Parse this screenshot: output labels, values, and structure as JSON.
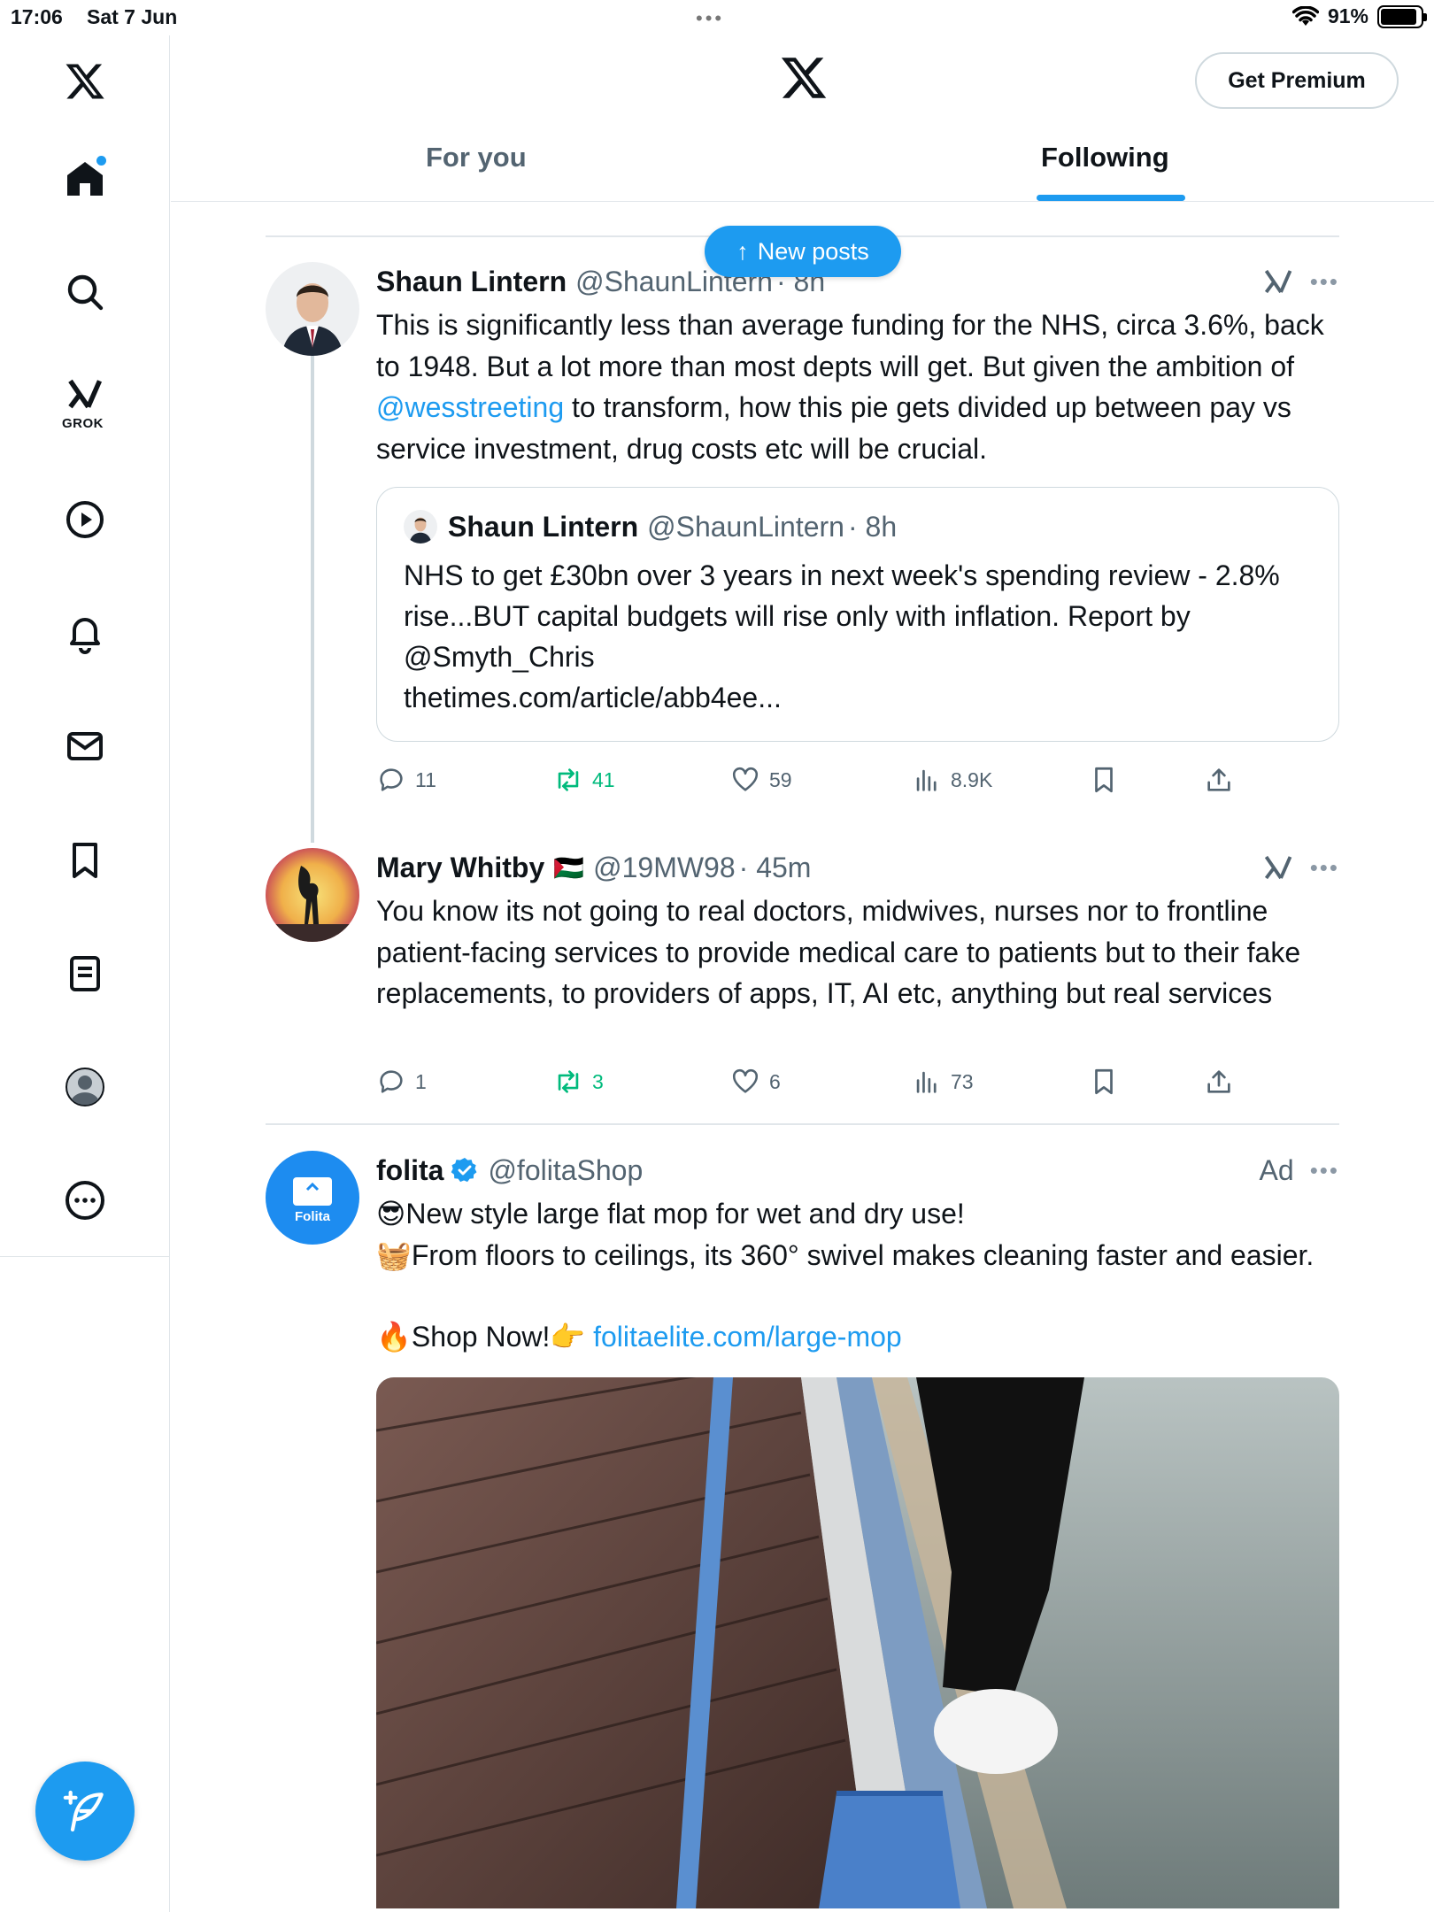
{
  "status_bar": {
    "time": "17:06",
    "date": "Sat 7 Jun",
    "battery": "91%"
  },
  "sidebar": {
    "grok_label": "GROK"
  },
  "header": {
    "premium_button": "Get Premium",
    "tabs": [
      "For you",
      "Following"
    ],
    "active_tab": "Following"
  },
  "new_posts_pill": "New posts",
  "posts": [
    {
      "author": "Shaun Lintern",
      "handle": "@ShaunLintern",
      "time": "· 8h",
      "text_before_mention": "This is significantly less than average funding for the NHS, circa 3.6%, back to 1948. But a lot more than most depts will get. But given the ambition of ",
      "mention": "@wesstreeting",
      "text_after_mention": " to transform, how this pie gets divided up between pay vs service investment, drug costs etc will be crucial.",
      "quote": {
        "author": "Shaun Lintern",
        "handle": "@ShaunLintern",
        "time": "· 8h",
        "text": "NHS to get £30bn over 3 years in next week's spending review - 2.8% rise...BUT capital budgets will rise only with inflation. Report by @Smyth_Chris",
        "link": "thetimes.com/article/abb4ee..."
      },
      "stats": {
        "replies": "11",
        "reposts": "41",
        "likes": "59",
        "views": "8.9K"
      }
    },
    {
      "author": "Mary Whitby",
      "flag": "🇵🇸",
      "handle": "@19MW98",
      "time": "· 45m",
      "text": "You know its not going to real doctors, midwives, nurses nor to frontline patient-facing services to provide medical care to patients but to their fake replacements, to providers of apps, IT, AI etc, anything but real services",
      "stats": {
        "replies": "1",
        "reposts": "3",
        "likes": "6",
        "views": "73"
      }
    },
    {
      "author": "folita",
      "handle": "@folitaShop",
      "ad_label": "Ad",
      "avatar_text": "Folita",
      "line1": "😎New style large flat mop for wet and dry use!",
      "line2": "🧺From floors to ceilings, its 360° swivel makes cleaning faster and easier.",
      "shop_text": "🔥Shop Now!👉 ",
      "shop_link": "folitaelite.com/large-mop"
    }
  ],
  "colors": {
    "accent": "#1d9bf0",
    "repost": "#00ba7c",
    "secondary_text": "#536471"
  }
}
